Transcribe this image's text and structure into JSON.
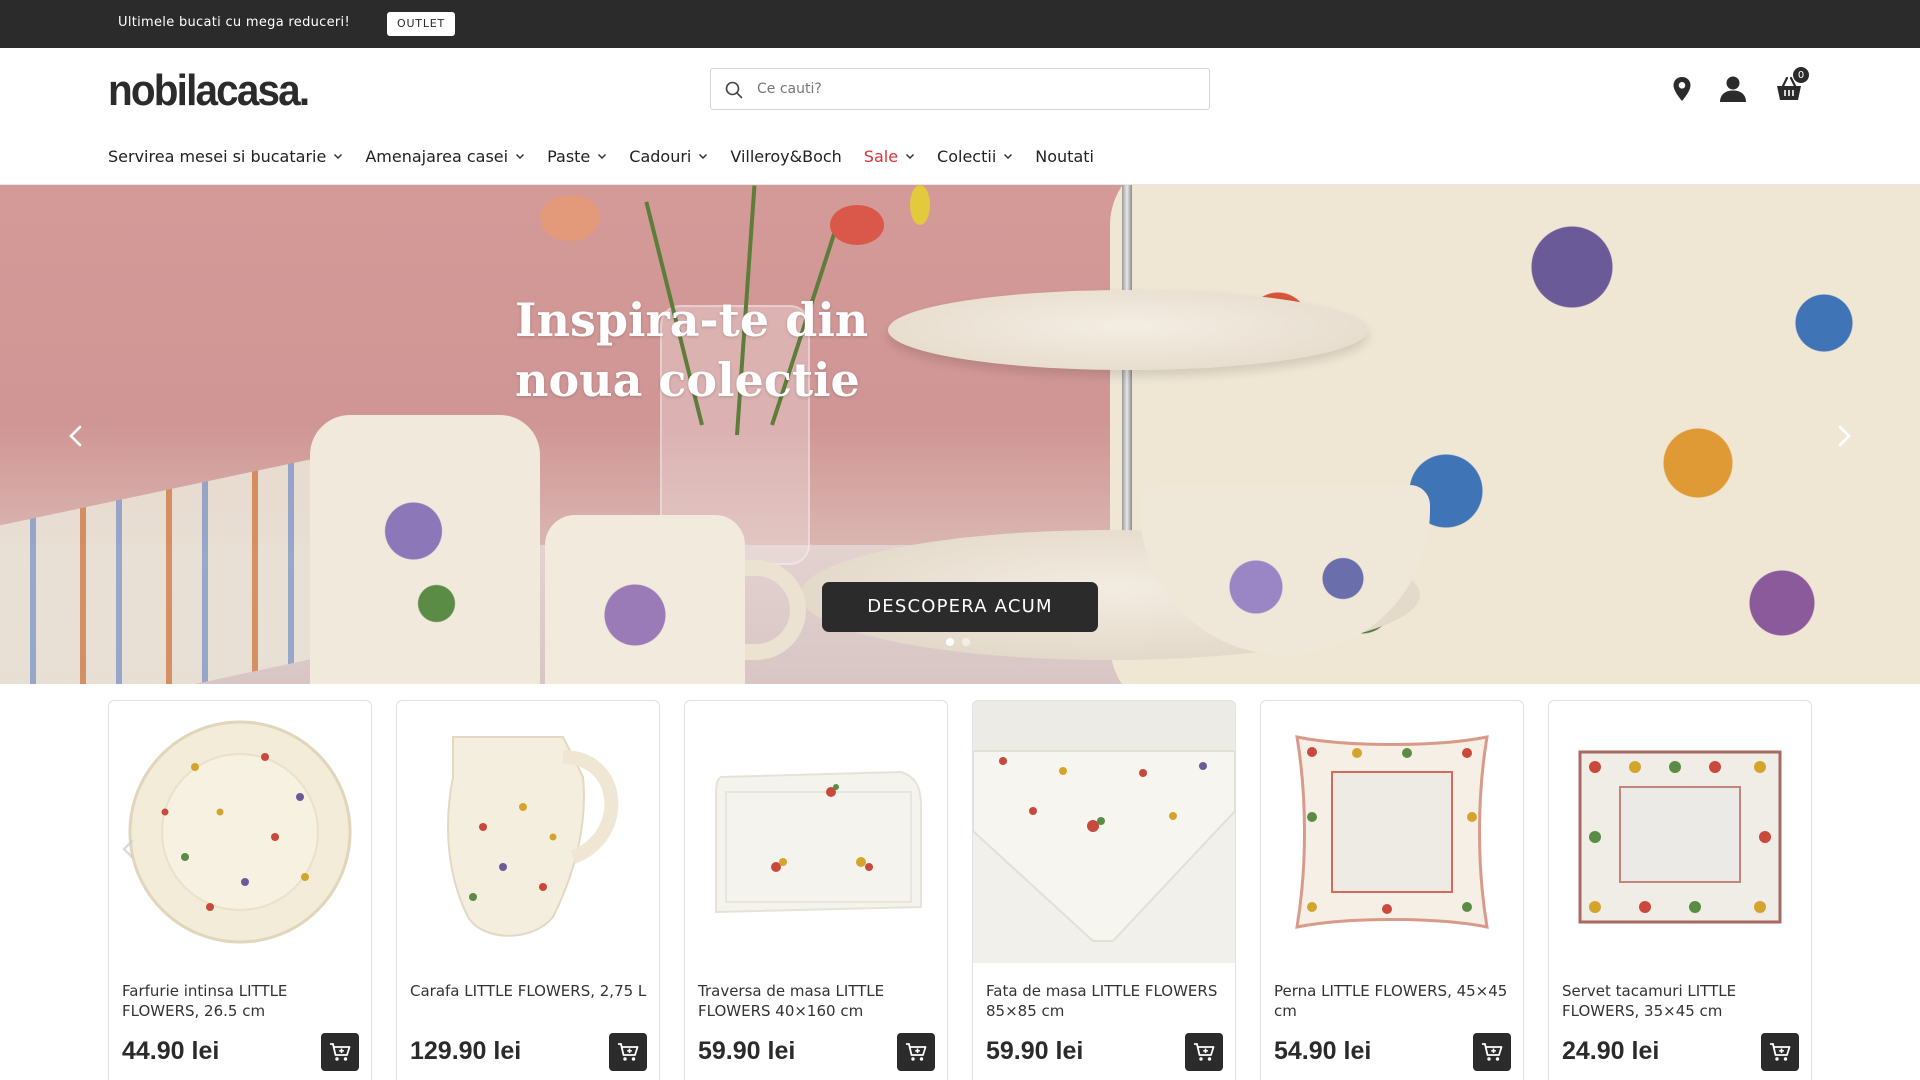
{
  "topbar": {
    "promo_text": "Ultimele bucati cu mega reduceri!",
    "outlet_label": "OUTLET"
  },
  "header": {
    "logo_text": "nobilacasa.",
    "search": {
      "placeholder": "Ce cauti?",
      "value": ""
    },
    "icons": [
      "location-pin-icon",
      "user-icon",
      "cart-icon"
    ],
    "cart_count": "0"
  },
  "nav": {
    "items": [
      {
        "label": "Servirea mesei si bucatarie",
        "has_dropdown": true
      },
      {
        "label": "Amenajarea casei",
        "has_dropdown": true
      },
      {
        "label": "Paste",
        "has_dropdown": true
      },
      {
        "label": "Cadouri",
        "has_dropdown": true
      },
      {
        "label": "Villeroy&Boch",
        "has_dropdown": false
      },
      {
        "label": "Sale",
        "has_dropdown": true
      },
      {
        "label": "Colectii",
        "has_dropdown": true
      },
      {
        "label": "Noutati",
        "has_dropdown": false
      }
    ]
  },
  "hero": {
    "title_line1": "Inspira-te din",
    "title_line2": "noua colectie",
    "cta_label": "DESCOPERA ACUM",
    "slides_total": 2,
    "active_slide": 1
  },
  "products": [
    {
      "name": "Farfurie intinsa LITTLE FLOWERS, 26.5 cm",
      "price": "44.90 lei"
    },
    {
      "name": "Carafa LITTLE FLOWERS, 2,75 L",
      "price": "129.90 lei"
    },
    {
      "name": "Traversa de masa LITTLE FLOWERS 40×160 cm",
      "price": "59.90 lei"
    },
    {
      "name": "Fata de masa LITTLE FLOWERS 85×85 cm",
      "price": "59.90 lei"
    },
    {
      "name": "Perna LITTLE FLOWERS, 45×45 cm",
      "price": "54.90 lei"
    },
    {
      "name": "Servet tacamuri LITTLE FLOWERS, 35×45 cm",
      "price": "24.90 lei"
    }
  ],
  "colors": {
    "dark": "#2b2b2b",
    "sale_red": "#d8343d",
    "hero_pink": "#d49a98"
  }
}
